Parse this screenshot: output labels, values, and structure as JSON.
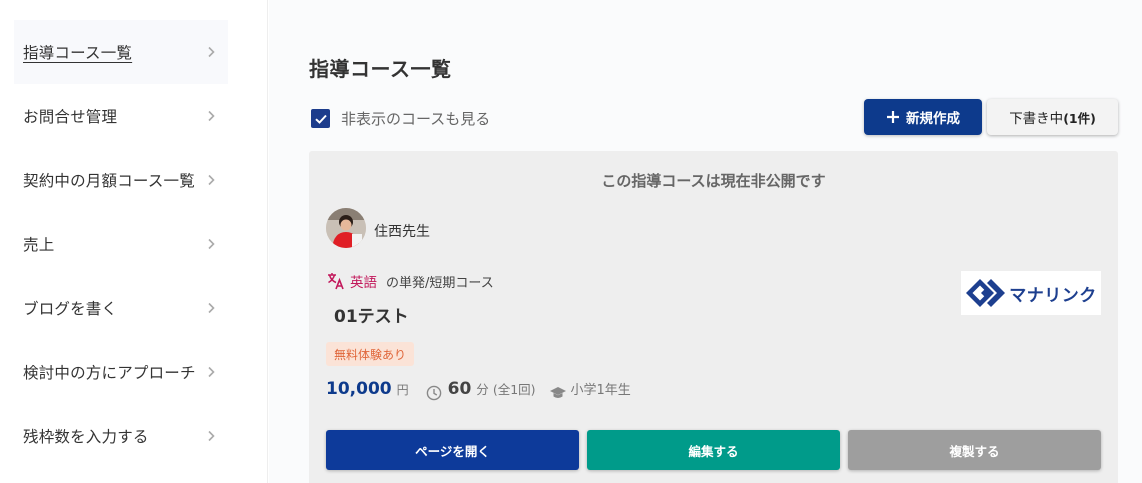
{
  "sidebar": {
    "items": [
      {
        "label": "指導コース一覧",
        "active": true
      },
      {
        "label": "お問合せ管理"
      },
      {
        "label": "契約中の月額コース一覧"
      },
      {
        "label": "売上"
      },
      {
        "label": "ブログを書く"
      },
      {
        "label": "検討中の方にアプローチ"
      },
      {
        "label": "残枠数を入力する"
      }
    ]
  },
  "main": {
    "title": "指導コース一覧",
    "show_hidden_label": "非表示のコースも見る",
    "show_hidden_checked": true,
    "new_button_label": "新規作成",
    "draft_button_label": "下書き中",
    "draft_count": "(1件)"
  },
  "course": {
    "notice": "この指導コースは現在非公開です",
    "teacher_name": "住西先生",
    "subject": "英語",
    "course_type": "の単発/短期コース",
    "title": "01テスト",
    "trial_badge": "無料体験あり",
    "price": "10,000",
    "price_unit": "円",
    "minutes": "60",
    "minutes_unit": "分",
    "sessions": "(全1回)",
    "grade": "小学1年生",
    "logo_text": "マナリンク",
    "buttons": {
      "open": "ページを開く",
      "edit": "編集する",
      "copy": "複製する"
    }
  },
  "colors": {
    "primary": "#0d3a8c",
    "teal": "#009b8a",
    "gray": "#9e9e9e",
    "subject": "#c2185b",
    "badge_bg": "#fbe3d7",
    "badge_text": "#e0663a"
  },
  "icons": [
    "chevron-right-icon",
    "check-icon",
    "plus-icon",
    "translate-icon",
    "clock-icon",
    "graduation-cap-icon"
  ]
}
